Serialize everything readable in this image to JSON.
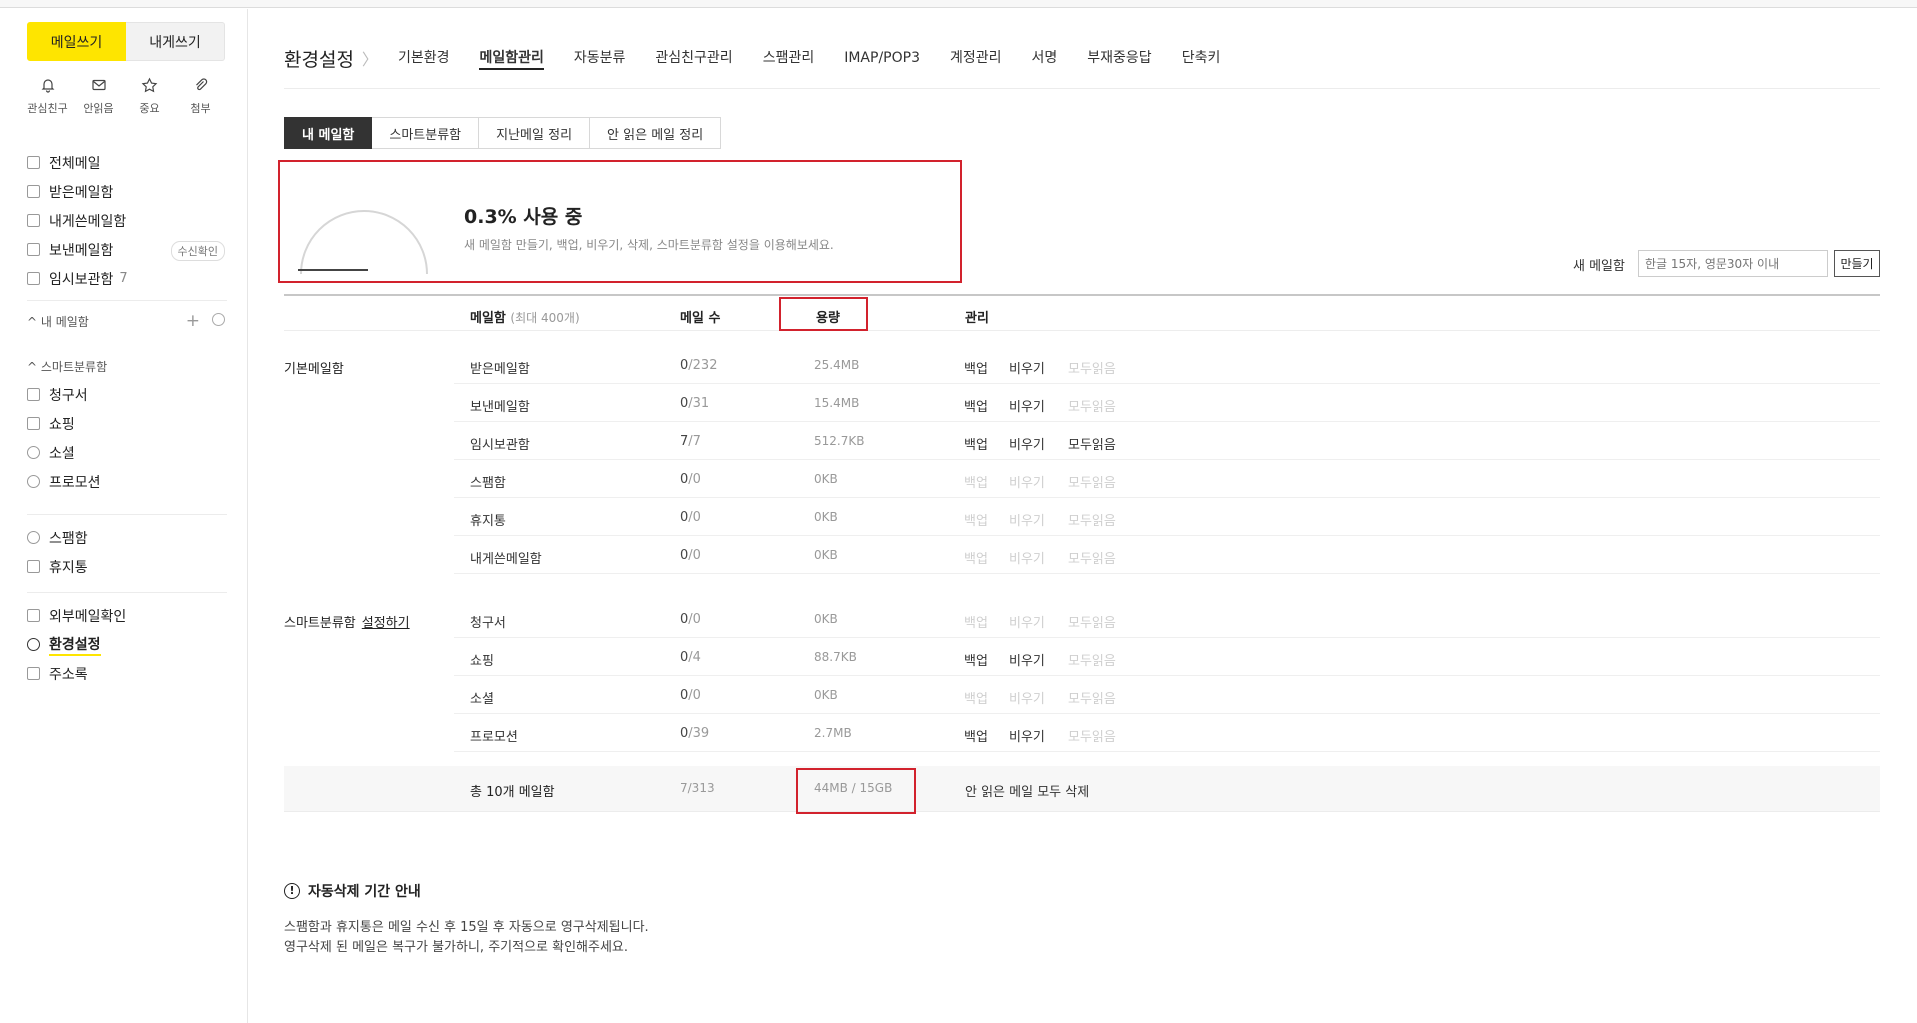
{
  "sidebar": {
    "compose_label": "메일쓰기",
    "tome_label": "내게쓰기",
    "quick": [
      {
        "icon": "bell-icon",
        "label": "관심친구"
      },
      {
        "icon": "envelope-icon",
        "label": "안읽음"
      },
      {
        "icon": "star-icon",
        "label": "중요"
      },
      {
        "icon": "paperclip-icon",
        "label": "첨부"
      }
    ],
    "mail_items": [
      {
        "label": "전체메일"
      },
      {
        "label": "받은메일함"
      },
      {
        "label": "내게쓴메일함"
      },
      {
        "label": "보낸메일함",
        "badge": "수신확인"
      },
      {
        "label": "임시보관함",
        "count": "7"
      }
    ],
    "mybox_label": "^ 내 메일함",
    "smart_label": "^ 스마트분류함",
    "smart_items": [
      {
        "label": "청구서"
      },
      {
        "label": "쇼핑"
      },
      {
        "label": "소셜"
      },
      {
        "label": "프로모션"
      }
    ],
    "etc_items": [
      {
        "label": "스팸함"
      },
      {
        "label": "휴지통"
      }
    ],
    "bottom_items": [
      {
        "label": "외부메일확인"
      },
      {
        "label": "환경설정"
      },
      {
        "label": "주소록"
      }
    ]
  },
  "nav": {
    "title": "환경설정",
    "items": [
      "기본환경",
      "메일함관리",
      "자동분류",
      "관심친구관리",
      "스팸관리",
      "IMAP/POP3",
      "계정관리",
      "서명",
      "부재중응답",
      "단축키"
    ],
    "active": "메일함관리"
  },
  "tabs": [
    "내 메일함",
    "스마트분류함",
    "지난메일 정리",
    "안 읽은 메일 정리"
  ],
  "usage": {
    "percent": 0.3,
    "title": "0.3% 사용 중",
    "desc": "새 메일함 만들기, 백업, 비우기, 삭제, 스마트분류함 설정을 이용해보세요."
  },
  "newbox": {
    "label": "새 메일함",
    "placeholder": "한글 15자, 영문30자 이내",
    "button": "만들기"
  },
  "table": {
    "headers": {
      "name": "메일함",
      "name_sub": "(최대 400개)",
      "count": "메일 수",
      "size": "용량",
      "manage": "관리"
    },
    "actions": {
      "backup": "백업",
      "empty": "비우기",
      "readall": "모두읽음"
    },
    "groups": [
      {
        "label": "기본메일함",
        "rows": [
          {
            "name": "받은메일함",
            "unread": "0",
            "total": "/232",
            "size": "25.4MB",
            "backup": true,
            "empty": true,
            "readall": false
          },
          {
            "name": "보낸메일함",
            "unread": "0",
            "total": "/31",
            "size": "15.4MB",
            "backup": true,
            "empty": true,
            "readall": false
          },
          {
            "name": "임시보관함",
            "unread": "7",
            "total": "/7",
            "size": "512.7KB",
            "backup": true,
            "empty": true,
            "readall": true
          },
          {
            "name": "스팸함",
            "unread": "0",
            "total": "/0",
            "size": "0KB",
            "backup": false,
            "empty": false,
            "readall": false
          },
          {
            "name": "휴지통",
            "unread": "0",
            "total": "/0",
            "size": "0KB",
            "backup": false,
            "empty": false,
            "readall": false
          },
          {
            "name": "내게쓴메일함",
            "unread": "0",
            "total": "/0",
            "size": "0KB",
            "backup": false,
            "empty": false,
            "readall": false
          }
        ]
      },
      {
        "label": "스마트분류함",
        "link": "설정하기",
        "rows": [
          {
            "name": "청구서",
            "unread": "0",
            "total": "/0",
            "size": "0KB",
            "backup": false,
            "empty": false,
            "readall": false
          },
          {
            "name": "쇼핑",
            "unread": "0",
            "total": "/4",
            "size": "88.7KB",
            "backup": true,
            "empty": true,
            "readall": false
          },
          {
            "name": "소셜",
            "unread": "0",
            "total": "/0",
            "size": "0KB",
            "backup": false,
            "empty": false,
            "readall": false
          },
          {
            "name": "프로모션",
            "unread": "0",
            "total": "/39",
            "size": "2.7MB",
            "backup": true,
            "empty": true,
            "readall": false
          }
        ]
      }
    ],
    "total": {
      "name": "총 10개 메일함",
      "count": "7/313",
      "size": "44MB / 15GB",
      "manage": "안 읽은 메일 모두 삭제"
    }
  },
  "notice": {
    "title": "자동삭제 기간 안내",
    "line1": "스팸함과 휴지통은 메일 수신 후 15일 후 자동으로 영구삭제됩니다.",
    "line2": "영구삭제 된 메일은 복구가 불가하니, 주기적으로 확인해주세요."
  },
  "colors": {
    "brand": "#fee500",
    "highlight_box": "#d2222d",
    "active_tab": "#333333"
  }
}
